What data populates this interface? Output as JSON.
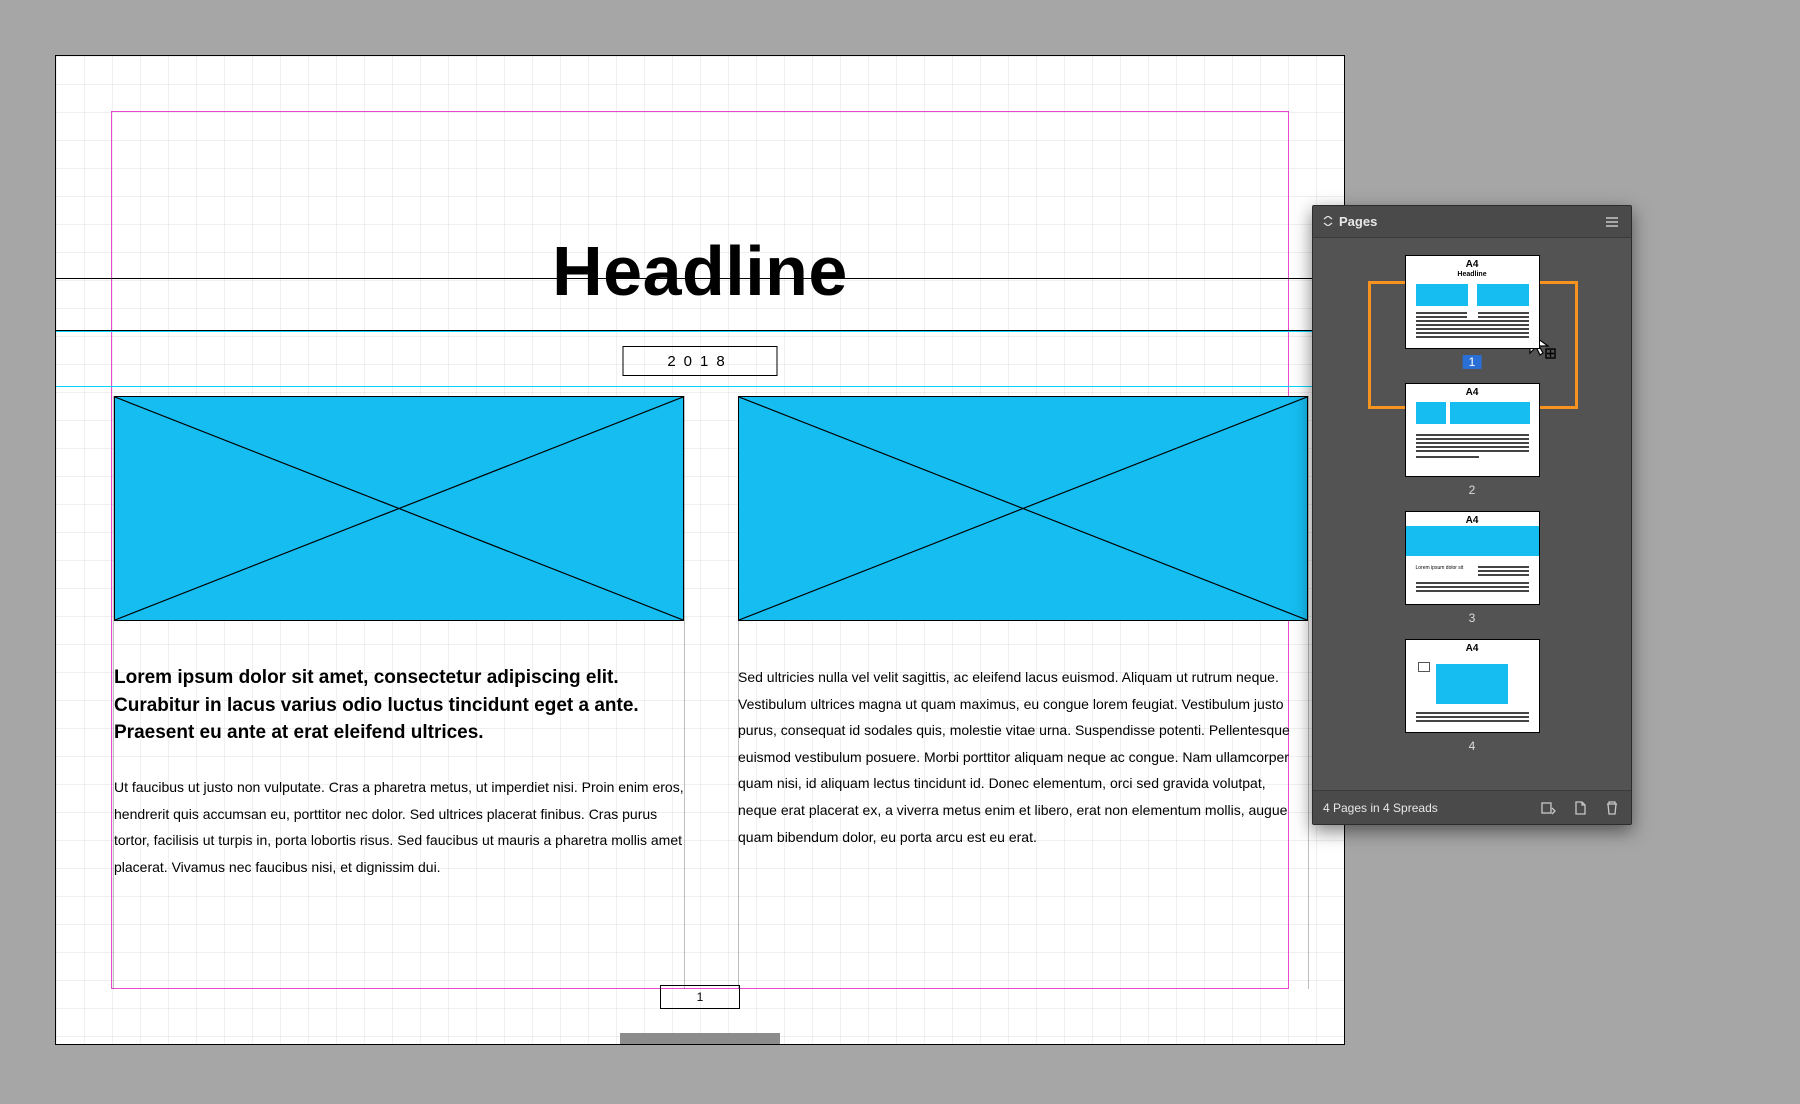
{
  "document": {
    "headline": "Headline",
    "year": "2018",
    "page_number": "1",
    "col_bold": "Lorem ipsum dolor sit amet, consectetur adipiscing elit. Curabitur in lacus varius odio luctus tincidunt eget a ante. Praesent eu ante at erat eleifend ultrices.",
    "col_text1": "Ut faucibus ut justo non vulputate. Cras a pharetra metus, ut imperdiet nisi. Proin enim eros, hendrerit quis accumsan eu, porttitor nec dolor. Sed ultrices placerat finibus. Cras purus tortor, facilisis ut turpis in, porta lobortis risus. Sed faucibus ut mauris a pharetra mollis amet placerat. Vivamus nec faucibus nisi, et dignissim dui.",
    "col_text2": "Sed ultricies nulla vel velit sagittis, ac eleifend lacus euismod. Aliquam ut rutrum neque. Vestibulum ultrices magna ut quam maximus, eu congue lorem feugiat. Vestibulum justo purus, consequat id sodales quis, molestie vitae urna. Suspendisse potenti. Pellentesque euismod vestibulum posuere. Morbi porttitor aliquam neque ac congue. Nam ullamcorper quam nisi, id aliquam lectus tincidunt id. Donec elementum, orci sed gravida volutpat, neque erat placerat ex, a viverra metus enim et libero, erat non elementum mollis, augue quam bibendum dolor, eu porta arcu est eu erat."
  },
  "panel": {
    "title": "Pages",
    "master_label": "A4",
    "thumbs": [
      {
        "num": "1",
        "active": true
      },
      {
        "num": "2",
        "active": false
      },
      {
        "num": "3",
        "active": false
      },
      {
        "num": "4",
        "active": false
      }
    ],
    "thumb3_caption": "Lorem ipsum dolor sit",
    "footer_status": "4 Pages in 4 Spreads"
  }
}
